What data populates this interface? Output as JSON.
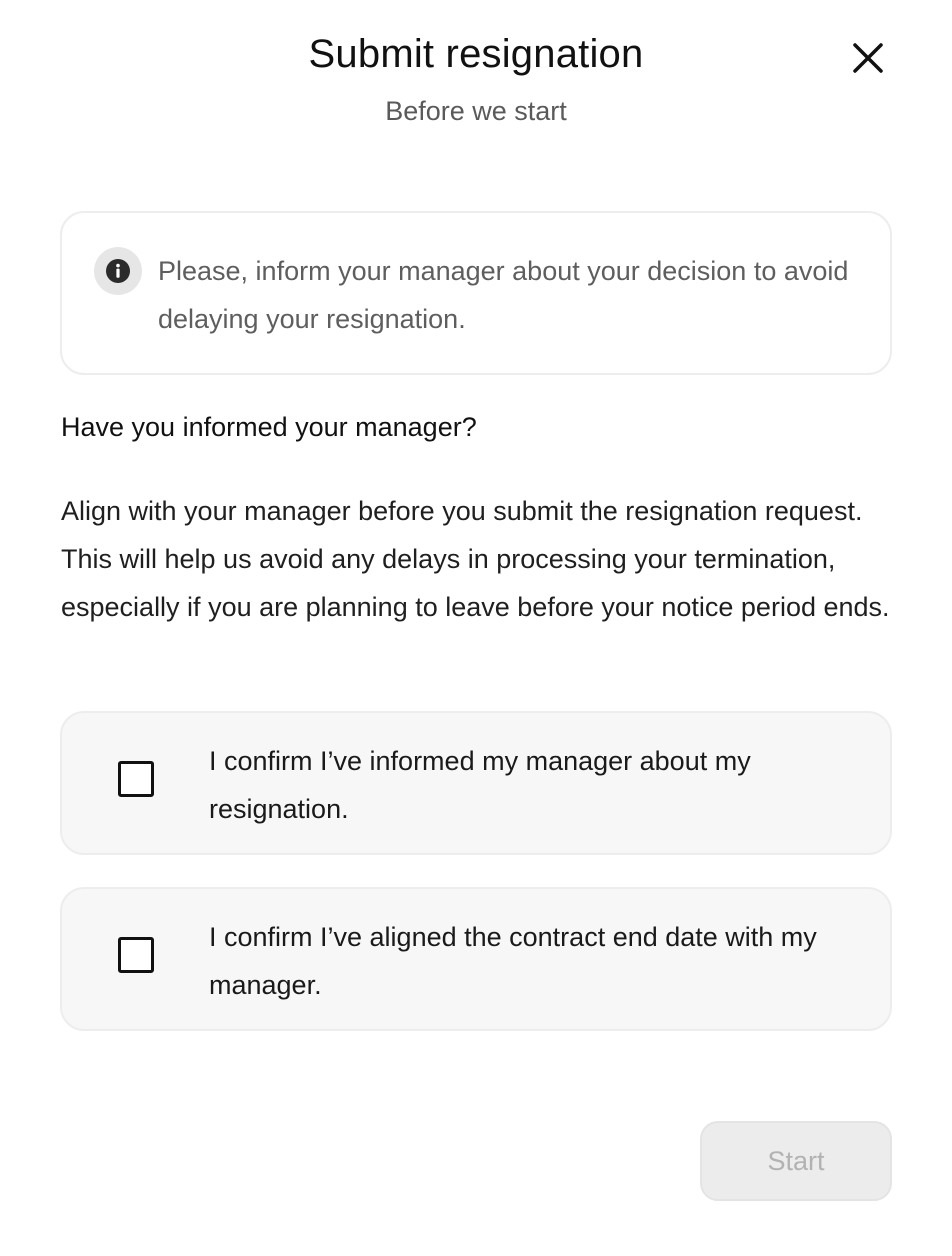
{
  "dialog": {
    "title": "Submit resignation",
    "subtitle": "Before we start",
    "close_icon": "close-icon"
  },
  "info": {
    "icon": "info-icon",
    "text": "Please, inform your manager about your decision to avoid delaying your resignation."
  },
  "section": {
    "question": "Have you informed your manager?",
    "description": "Align with your manager before you submit the resignation request. This will help us avoid any delays in processing your termination, especially if you are planning to leave before your notice period ends."
  },
  "confirmations": [
    {
      "label": "I confirm I’ve informed my manager about my resignation.",
      "checked": false
    },
    {
      "label": "I confirm I’ve aligned the contract end date with my manager.",
      "checked": false
    }
  ],
  "footer": {
    "start_label": "Start",
    "start_disabled": true
  },
  "colors": {
    "text_primary": "#111111",
    "text_secondary": "#5e5e5e",
    "card_background": "#f7f7f7",
    "disabled_button": "#ececec",
    "disabled_text": "#b2b2b2"
  }
}
